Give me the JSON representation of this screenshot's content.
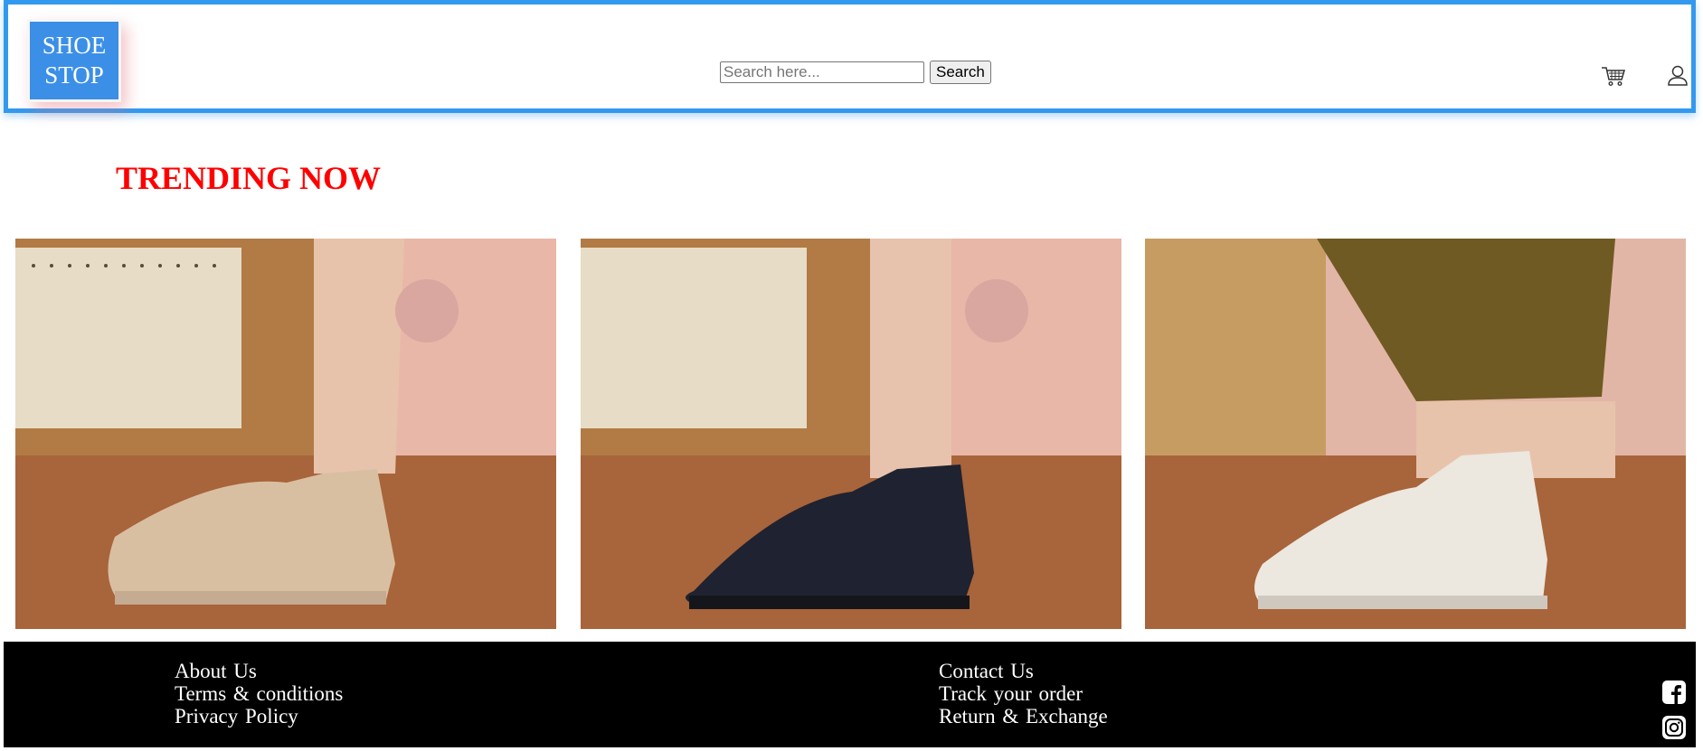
{
  "header": {
    "logo_line1": "SHOE",
    "logo_line2": "STOP",
    "search_placeholder": "Search here...",
    "search_button": "Search",
    "icons": [
      "cart-icon",
      "user-icon"
    ]
  },
  "main": {
    "heading": "TRENDING NOW",
    "products": [
      {
        "name": "Beige quilted ankle boot",
        "color": "#d9bfa2"
      },
      {
        "name": "Black quilted ankle boot",
        "color": "#1f2230"
      },
      {
        "name": "White quilted ankle boot",
        "color": "#ece7df"
      }
    ]
  },
  "footer": {
    "column1": [
      "About Us",
      "Terms & conditions",
      "Privacy Policy"
    ],
    "column2": [
      "Contact Us",
      "Track your order",
      "Return & Exchange"
    ],
    "social_icons": [
      "facebook-icon",
      "instagram-icon"
    ]
  },
  "colors": {
    "header_border": "#3399ee",
    "logo_bg": "#3b8fe7",
    "heading": "#ff0000",
    "footer_bg": "#000000"
  }
}
